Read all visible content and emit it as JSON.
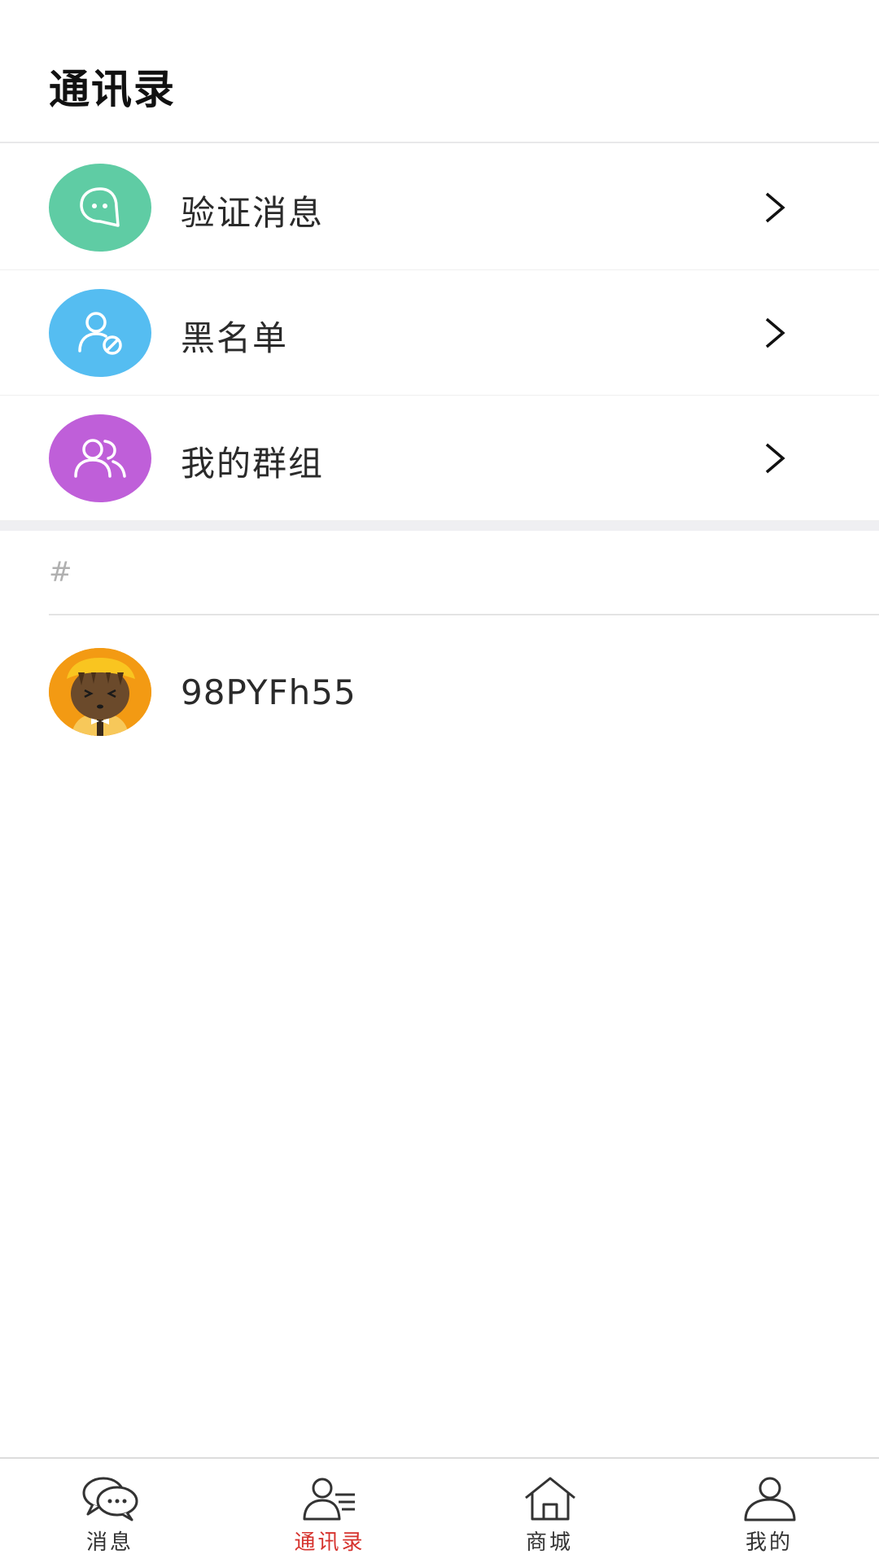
{
  "header": {
    "title": "通讯录"
  },
  "menu": [
    {
      "label": "验证消息",
      "icon": "chat-bubble-icon",
      "color": "#5fcca4"
    },
    {
      "label": "黑名单",
      "icon": "user-blocked-icon",
      "color": "#55bdf1"
    },
    {
      "label": "我的群组",
      "icon": "group-icon",
      "color": "#bf5fd9"
    }
  ],
  "index": {
    "letter": "#"
  },
  "contacts": [
    {
      "name": "98PYFh55",
      "avatar": "cartoon-avatar"
    }
  ],
  "tabs": [
    {
      "label": "消息",
      "icon": "messages-icon",
      "active": false
    },
    {
      "label": "通讯录",
      "icon": "contacts-icon",
      "active": true
    },
    {
      "label": "商城",
      "icon": "home-icon",
      "active": false
    },
    {
      "label": "我的",
      "icon": "profile-icon",
      "active": false
    }
  ],
  "colors": {
    "accent": "#d6332e",
    "separator": "#efeff2"
  }
}
